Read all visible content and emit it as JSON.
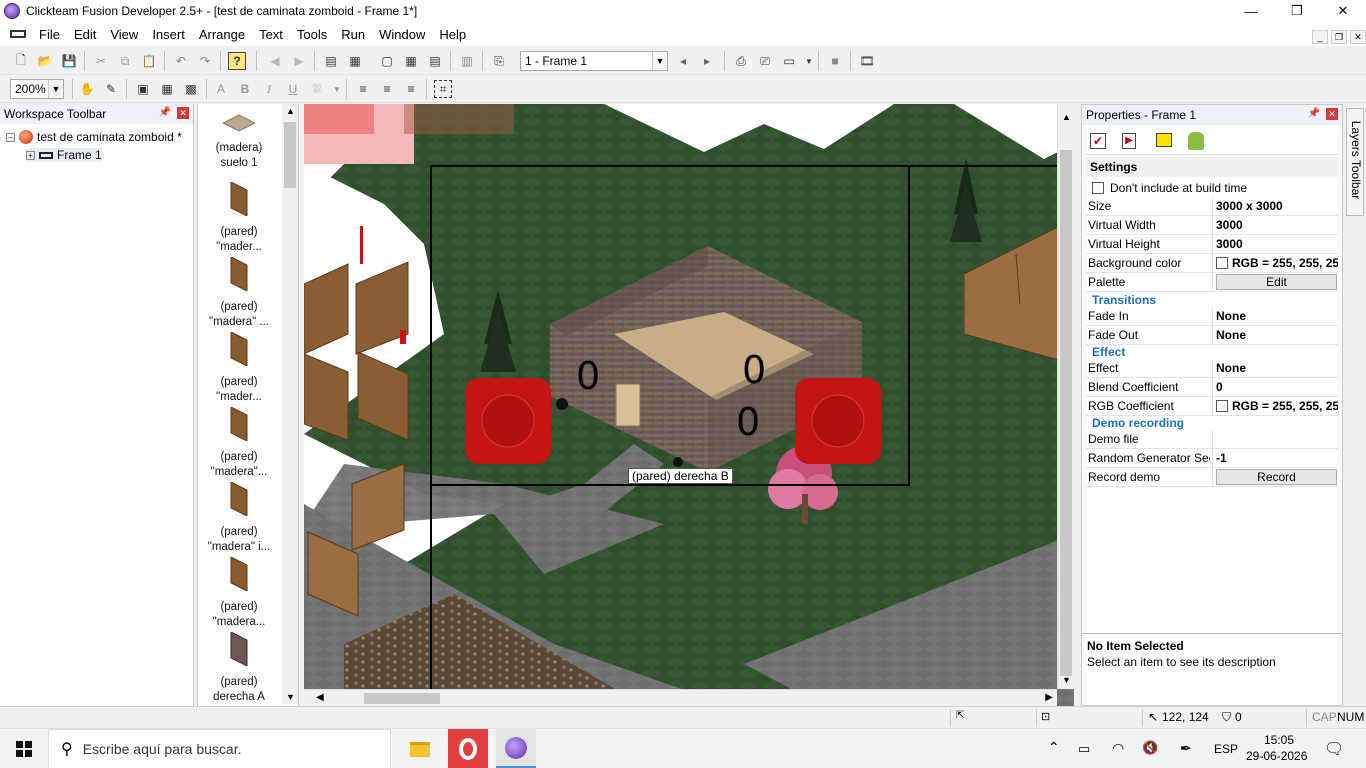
{
  "window": {
    "title": "Clickteam Fusion Developer 2.5+ - [test de caminata zomboid - Frame 1*]",
    "minimize": "—",
    "maximize": "❐",
    "close": "✕"
  },
  "menu": [
    "File",
    "Edit",
    "View",
    "Insert",
    "Arrange",
    "Text",
    "Tools",
    "Run",
    "Window",
    "Help"
  ],
  "toolbar": {
    "frame_select": "1 - Frame 1",
    "zoom": "200%",
    "bold": "B",
    "italic": "I",
    "underline": "U"
  },
  "workspace": {
    "header": "Workspace Toolbar",
    "project": "test de caminata zomboid *",
    "frame": "Frame 1"
  },
  "objects": [
    {
      "label": "(madera)\nsuelo 1",
      "icon": "floor-tile-icon"
    },
    {
      "label": "(pared)\n\"mader...",
      "icon": "wall-icon"
    },
    {
      "label": "(pared)\n\"madera\" ...",
      "icon": "wall-icon"
    },
    {
      "label": "(pared)\n\"mader...",
      "icon": "wall-icon"
    },
    {
      "label": "(pared)\n\"madera\"...",
      "icon": "wall-icon"
    },
    {
      "label": "(pared)\n\"madera\" i...",
      "icon": "wall-icon"
    },
    {
      "label": "(pared)\n\"madera...",
      "icon": "wall-icon"
    },
    {
      "label": "(pared)\nderecha A",
      "icon": "wall-icon"
    }
  ],
  "editor": {
    "tooltip": "(pared) derecha B",
    "counters": [
      "0",
      "0",
      "0"
    ]
  },
  "properties": {
    "header": "Properties - Frame 1",
    "settings_title": "Settings",
    "dont_include": "Don't include at build time",
    "rows": [
      {
        "key": "Size",
        "value": "3000 x 3000"
      },
      {
        "key": "Virtual Width",
        "value": "3000"
      },
      {
        "key": "Virtual Height",
        "value": "3000"
      },
      {
        "key": "Background color",
        "value": "RGB = 255, 255, 25"
      },
      {
        "key": "Palette",
        "button": "Edit"
      }
    ],
    "transitions_title": "Transitions",
    "transitions": [
      {
        "key": "Fade In",
        "value": "None"
      },
      {
        "key": "Fade Out",
        "value": "None"
      }
    ],
    "effect_title": "Effect",
    "effect": [
      {
        "key": "Effect",
        "value": "None"
      },
      {
        "key": "Blend Coefficient",
        "value": "0"
      },
      {
        "key": "RGB Coefficient",
        "value": "RGB = 255, 255, 25"
      }
    ],
    "demo_title": "Demo recording",
    "demo": [
      {
        "key": "Demo file",
        "value": ""
      },
      {
        "key": "Random Generator See",
        "value": "-1"
      },
      {
        "key": "Record demo",
        "button": "Record"
      }
    ],
    "desc_title": "No Item Selected",
    "desc_text": "Select an item to see its description"
  },
  "layers_tab": "Layers Toolbar",
  "status": {
    "coords": "122, 124",
    "count": "0",
    "caps": "CAP",
    "num": "NUM"
  },
  "taskbar": {
    "search_placeholder": "Escribe aquí para buscar.",
    "lang": "ESP",
    "time": "15:05",
    "date": "29-06-2026"
  },
  "colors": {
    "grass": "#2f4f2c",
    "road": "#707070",
    "brick": "#6e5e55",
    "button_red": "#c41414",
    "section_blue": "#1a6fc7"
  }
}
